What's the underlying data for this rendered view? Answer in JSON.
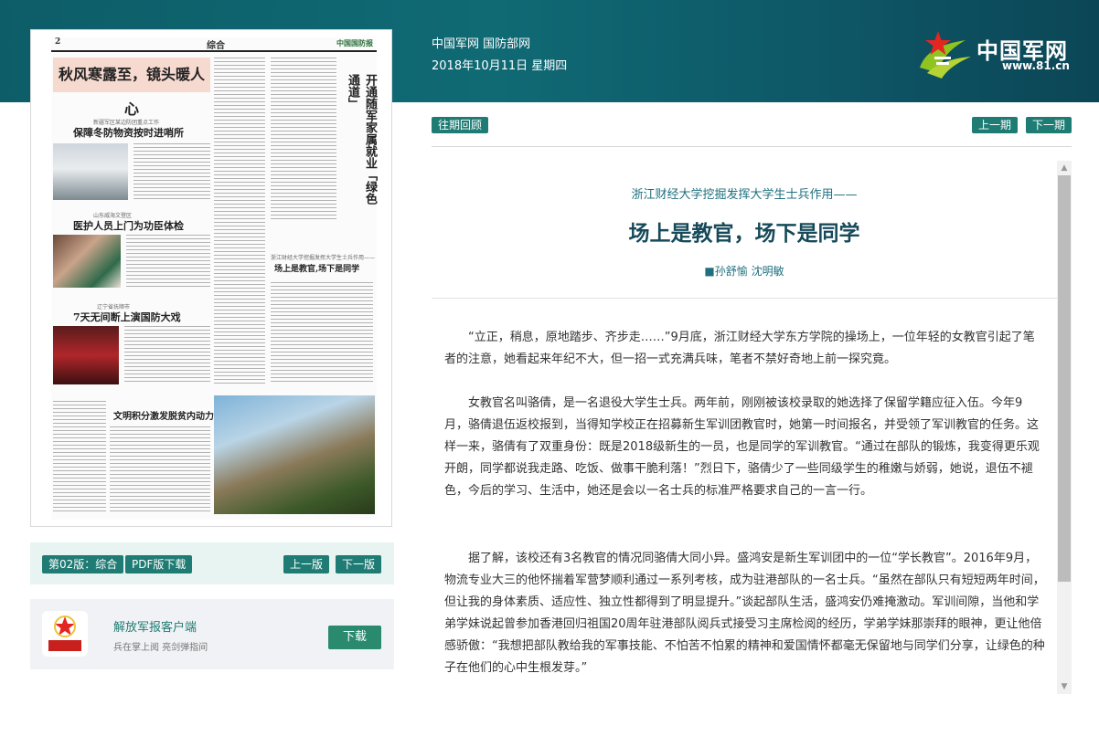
{
  "header": {
    "site_links": "中国军网 国防部网",
    "date": "2018年10月11日 星期四",
    "logo_text": "中国军网",
    "logo_url": "www.81.cn"
  },
  "newspaper": {
    "page_no": "2",
    "section": "综合",
    "brand": "中国国防报",
    "banner": "秋风寒露至，镜头暖人心",
    "story1_kicker": "新疆军区某边防团重点工作",
    "story1_title": "保障冬防物资按时进哨所",
    "story2_kicker": "山东威海文登区",
    "story2_title": "医护人员上门为功臣体检",
    "story3_kicker": "辽宁省抚顺市",
    "story3_title": "7天无间断上演国防大戏",
    "story4_title": "文明积分激发脱贫内动力",
    "side_kicker": "浙江财经大学挖掘发挥大学生士兵作用——",
    "side_title": "场上是教官,场下是同学",
    "vertical_title": "开通随军家属就业「绿色通道」"
  },
  "pager": {
    "edition": "第02版：综合",
    "pdf": "PDF版下载",
    "prev": "上一版",
    "next": "下一版"
  },
  "app": {
    "name": "解放军报客户端",
    "tagline": "兵在掌上阅 亮剑弹指间",
    "download": "下载",
    "logo_text": "解放军报"
  },
  "issue_nav": {
    "archive": "往期回顾",
    "prev": "上一期",
    "next": "下一期"
  },
  "article": {
    "subhead": "浙江财经大学挖掘发挥大学生士兵作用——",
    "headline": "场上是教官，场下是同学",
    "byline": "■孙舒愉 沈明敏",
    "paragraphs": [
      "“立正，稍息，原地踏步、齐步走……”9月底，浙江财经大学东方学院的操场上，一位年轻的女教官引起了笔者的注意，她看起来年纪不大，但一招一式充满兵味，笔者不禁好奇地上前一探究竟。",
      "女教官名叫骆倩，是一名退役大学生士兵。两年前，刚刚被该校录取的她选择了保留学籍应征入伍。今年9月，骆倩退伍返校报到，当得知学校正在招募新生军训团教官时，她第一时间报名，并受领了军训教官的任务。这样一来，骆倩有了双重身份：既是2018级新生的一员，也是同学的军训教官。“通过在部队的锻炼，我变得更乐观开朗，同学都说我走路、吃饭、做事干脆利落！”烈日下，骆倩少了一些同级学生的稚嫩与娇弱，她说，退伍不褪色，今后的学习、生活中，她还是会以一名士兵的标准严格要求自己的一言一行。",
      "据了解，该校还有3名教官的情况同骆倩大同小异。盛鸿安是新生军训团中的一位“学长教官”。2016年9月，物流专业大三的他怀揣着军营梦顺利通过一系列考核，成为驻港部队的一名士兵。“虽然在部队只有短短两年时间，但让我的身体素质、适应性、独立性都得到了明显提升。”谈起部队生活，盛鸿安仍难掩激动。军训间隙，当他和学弟学妹说起曾参加香港回归祖国20周年驻港部队阅兵式接受习主席检阅的经历，学弟学妹那崇拜的眼神，更让他倍感骄傲：“我想把部队教给我的军事技能、不怕苦不怕累的精神和爱国情怀都毫无保留地与同学们分享，让绿色的种子在他们的心中生根发芽。”"
    ]
  }
}
